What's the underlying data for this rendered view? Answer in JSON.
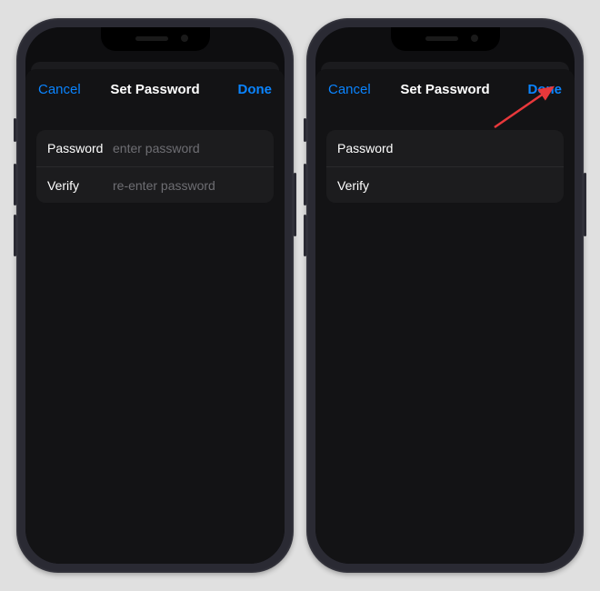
{
  "colors": {
    "accent": "#0a84ff",
    "annotation_arrow": "#e8383b"
  },
  "phones": [
    {
      "nav": {
        "cancel": "Cancel",
        "title": "Set Password",
        "done": "Done"
      },
      "fields": {
        "password_label": "Password",
        "password_placeholder": "enter password",
        "password_value": "",
        "verify_label": "Verify",
        "verify_placeholder": "re-enter password",
        "verify_value": ""
      }
    },
    {
      "nav": {
        "cancel": "Cancel",
        "title": "Set Password",
        "done": "Done"
      },
      "fields": {
        "password_label": "Password",
        "password_placeholder": "",
        "password_value": "",
        "verify_label": "Verify",
        "verify_placeholder": "",
        "verify_value": ""
      }
    }
  ]
}
